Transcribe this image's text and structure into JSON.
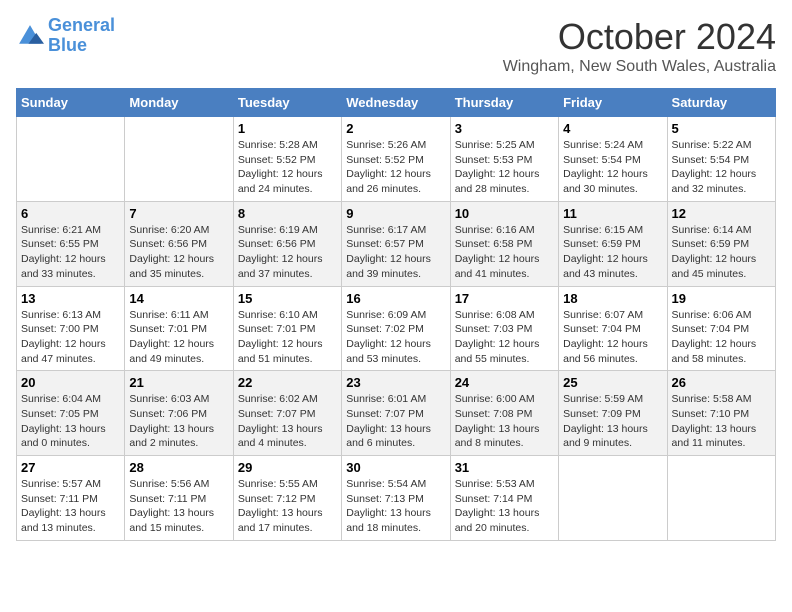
{
  "header": {
    "logo_line1": "General",
    "logo_line2": "Blue",
    "month_title": "October 2024",
    "subtitle": "Wingham, New South Wales, Australia"
  },
  "days_of_week": [
    "Sunday",
    "Monday",
    "Tuesday",
    "Wednesday",
    "Thursday",
    "Friday",
    "Saturday"
  ],
  "weeks": [
    [
      {
        "day": "",
        "info": ""
      },
      {
        "day": "",
        "info": ""
      },
      {
        "day": "1",
        "info": "Sunrise: 5:28 AM\nSunset: 5:52 PM\nDaylight: 12 hours and 24 minutes."
      },
      {
        "day": "2",
        "info": "Sunrise: 5:26 AM\nSunset: 5:52 PM\nDaylight: 12 hours and 26 minutes."
      },
      {
        "day": "3",
        "info": "Sunrise: 5:25 AM\nSunset: 5:53 PM\nDaylight: 12 hours and 28 minutes."
      },
      {
        "day": "4",
        "info": "Sunrise: 5:24 AM\nSunset: 5:54 PM\nDaylight: 12 hours and 30 minutes."
      },
      {
        "day": "5",
        "info": "Sunrise: 5:22 AM\nSunset: 5:54 PM\nDaylight: 12 hours and 32 minutes."
      }
    ],
    [
      {
        "day": "6",
        "info": "Sunrise: 6:21 AM\nSunset: 6:55 PM\nDaylight: 12 hours and 33 minutes."
      },
      {
        "day": "7",
        "info": "Sunrise: 6:20 AM\nSunset: 6:56 PM\nDaylight: 12 hours and 35 minutes."
      },
      {
        "day": "8",
        "info": "Sunrise: 6:19 AM\nSunset: 6:56 PM\nDaylight: 12 hours and 37 minutes."
      },
      {
        "day": "9",
        "info": "Sunrise: 6:17 AM\nSunset: 6:57 PM\nDaylight: 12 hours and 39 minutes."
      },
      {
        "day": "10",
        "info": "Sunrise: 6:16 AM\nSunset: 6:58 PM\nDaylight: 12 hours and 41 minutes."
      },
      {
        "day": "11",
        "info": "Sunrise: 6:15 AM\nSunset: 6:59 PM\nDaylight: 12 hours and 43 minutes."
      },
      {
        "day": "12",
        "info": "Sunrise: 6:14 AM\nSunset: 6:59 PM\nDaylight: 12 hours and 45 minutes."
      }
    ],
    [
      {
        "day": "13",
        "info": "Sunrise: 6:13 AM\nSunset: 7:00 PM\nDaylight: 12 hours and 47 minutes."
      },
      {
        "day": "14",
        "info": "Sunrise: 6:11 AM\nSunset: 7:01 PM\nDaylight: 12 hours and 49 minutes."
      },
      {
        "day": "15",
        "info": "Sunrise: 6:10 AM\nSunset: 7:01 PM\nDaylight: 12 hours and 51 minutes."
      },
      {
        "day": "16",
        "info": "Sunrise: 6:09 AM\nSunset: 7:02 PM\nDaylight: 12 hours and 53 minutes."
      },
      {
        "day": "17",
        "info": "Sunrise: 6:08 AM\nSunset: 7:03 PM\nDaylight: 12 hours and 55 minutes."
      },
      {
        "day": "18",
        "info": "Sunrise: 6:07 AM\nSunset: 7:04 PM\nDaylight: 12 hours and 56 minutes."
      },
      {
        "day": "19",
        "info": "Sunrise: 6:06 AM\nSunset: 7:04 PM\nDaylight: 12 hours and 58 minutes."
      }
    ],
    [
      {
        "day": "20",
        "info": "Sunrise: 6:04 AM\nSunset: 7:05 PM\nDaylight: 13 hours and 0 minutes."
      },
      {
        "day": "21",
        "info": "Sunrise: 6:03 AM\nSunset: 7:06 PM\nDaylight: 13 hours and 2 minutes."
      },
      {
        "day": "22",
        "info": "Sunrise: 6:02 AM\nSunset: 7:07 PM\nDaylight: 13 hours and 4 minutes."
      },
      {
        "day": "23",
        "info": "Sunrise: 6:01 AM\nSunset: 7:07 PM\nDaylight: 13 hours and 6 minutes."
      },
      {
        "day": "24",
        "info": "Sunrise: 6:00 AM\nSunset: 7:08 PM\nDaylight: 13 hours and 8 minutes."
      },
      {
        "day": "25",
        "info": "Sunrise: 5:59 AM\nSunset: 7:09 PM\nDaylight: 13 hours and 9 minutes."
      },
      {
        "day": "26",
        "info": "Sunrise: 5:58 AM\nSunset: 7:10 PM\nDaylight: 13 hours and 11 minutes."
      }
    ],
    [
      {
        "day": "27",
        "info": "Sunrise: 5:57 AM\nSunset: 7:11 PM\nDaylight: 13 hours and 13 minutes."
      },
      {
        "day": "28",
        "info": "Sunrise: 5:56 AM\nSunset: 7:11 PM\nDaylight: 13 hours and 15 minutes."
      },
      {
        "day": "29",
        "info": "Sunrise: 5:55 AM\nSunset: 7:12 PM\nDaylight: 13 hours and 17 minutes."
      },
      {
        "day": "30",
        "info": "Sunrise: 5:54 AM\nSunset: 7:13 PM\nDaylight: 13 hours and 18 minutes."
      },
      {
        "day": "31",
        "info": "Sunrise: 5:53 AM\nSunset: 7:14 PM\nDaylight: 13 hours and 20 minutes."
      },
      {
        "day": "",
        "info": ""
      },
      {
        "day": "",
        "info": ""
      }
    ]
  ]
}
